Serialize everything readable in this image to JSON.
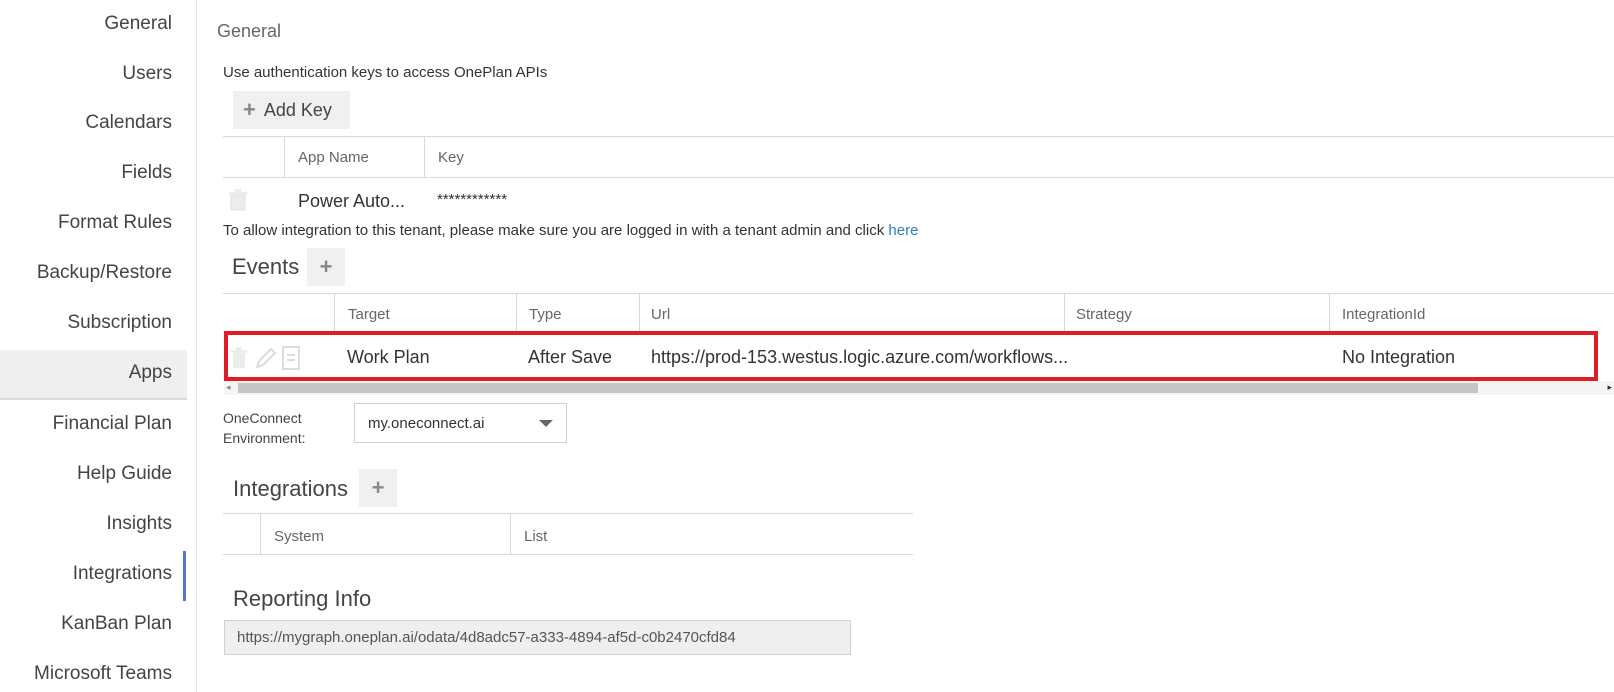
{
  "sidebar": {
    "items": [
      {
        "label": "General"
      },
      {
        "label": "Users"
      },
      {
        "label": "Calendars"
      },
      {
        "label": "Fields"
      },
      {
        "label": "Format Rules"
      },
      {
        "label": "Backup/Restore"
      },
      {
        "label": "Subscription"
      },
      {
        "label": "Apps"
      },
      {
        "label": "Financial Plan"
      },
      {
        "label": "Help Guide"
      },
      {
        "label": "Insights"
      },
      {
        "label": "Integrations"
      },
      {
        "label": "KanBan Plan"
      },
      {
        "label": "Microsoft Teams"
      }
    ],
    "active": "Apps"
  },
  "general": {
    "title": "General",
    "description": "Use authentication keys to access OnePlan APIs",
    "add_key_label": "Add Key",
    "keys_table": {
      "columns": [
        "App Name",
        "Key"
      ],
      "rows": [
        {
          "app_name": "Power Auto...",
          "key": "************"
        }
      ]
    },
    "integration_text": "To allow integration to this tenant, please make sure you are logged in with a tenant admin and click",
    "integration_link": "here"
  },
  "events": {
    "title": "Events",
    "columns": [
      "Target",
      "Type",
      "Url",
      "Strategy",
      "IntegrationId"
    ],
    "rows": [
      {
        "target": "Work Plan",
        "type": "After Save",
        "url": "https://prod-153.westus.logic.azure.com/workflows...",
        "strategy": "",
        "integration_id": "No Integration"
      }
    ]
  },
  "environment": {
    "label_line1": "OneConnect",
    "label_line2": "Environment:",
    "selected": "my.oneconnect.ai"
  },
  "integrations": {
    "title": "Integrations",
    "columns": [
      "System",
      "List"
    ]
  },
  "reporting": {
    "title": "Reporting Info",
    "url": "https://mygraph.oneplan.ai/odata/4d8adc57-a333-4894-af5d-c0b2470cfd84"
  },
  "colors": {
    "accent": "#5b73d6",
    "highlight": "#e01c24",
    "link": "#2d7fc6"
  }
}
